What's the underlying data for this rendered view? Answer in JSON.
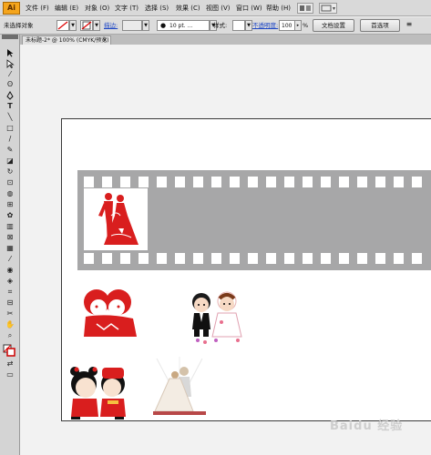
{
  "app": {
    "logo": "Ai"
  },
  "menu": {
    "items": [
      "文件 (F)",
      "编辑 (E)",
      "对象 (O)",
      "文字 (T)",
      "选择 (S)",
      "效果 (C)",
      "视图 (V)",
      "窗口 (W)",
      "帮助 (H)"
    ]
  },
  "control_bar": {
    "selection_label": "未选择对象",
    "stroke_label": "描边:",
    "brush_value": "10 pt. ...",
    "style_label": "样式:",
    "opacity_label": "不透明度:",
    "opacity_value": "100",
    "opacity_unit": "%",
    "doc_setup_button": "文档设置",
    "preferences_button": "首选项"
  },
  "document_tab": {
    "title": "未标题-2* @ 100% (CMYK/预览)",
    "close": "×"
  },
  "watermark": "Baidu 经验",
  "colors": {
    "accent_red": "#d91e1e",
    "film_gray": "#a7a7a8",
    "logo_orange": "#f5a51c"
  },
  "icons": [
    "ai-logo-icon",
    "selection-tool-icon",
    "direct-selection-tool-icon",
    "magic-wand-icon",
    "lasso-icon",
    "pen-tool-icon",
    "type-tool-icon",
    "line-tool-icon",
    "rectangle-tool-icon",
    "paintbrush-icon",
    "pencil-icon",
    "eraser-icon",
    "rotate-icon",
    "scale-icon",
    "warp-icon",
    "free-transform-icon",
    "symbol-sprayer-icon",
    "graph-icon",
    "mesh-icon",
    "gradient-icon",
    "eyedropper-icon",
    "blend-icon",
    "live-paint-icon",
    "crop-icon",
    "slice-icon",
    "scissors-icon",
    "hand-icon",
    "zoom-icon",
    "fill-stroke-icon",
    "swap-icon",
    "screen-mode-icon"
  ]
}
